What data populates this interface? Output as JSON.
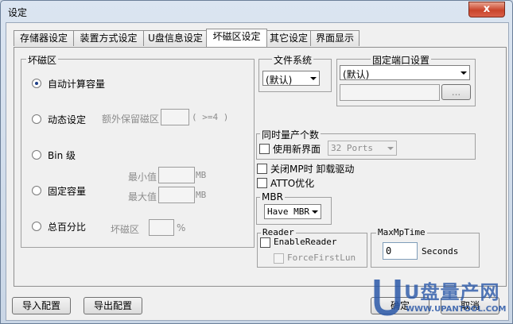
{
  "window": {
    "title": "设定",
    "close_glyph": "x"
  },
  "tabs": [
    {
      "label": "存储器设定"
    },
    {
      "label": "装置方式设定"
    },
    {
      "label": "U盘信息设定"
    },
    {
      "label": "坏磁区设定",
      "active": true
    },
    {
      "label": "其它设定"
    },
    {
      "label": "界面显示"
    }
  ],
  "bad_block": {
    "group_title": "坏磁区",
    "auto": {
      "label": "自动计算容量",
      "selected": true
    },
    "dynamic": {
      "label": "动态设定",
      "extra_label": "额外保留磁区",
      "hint": "( >=4 )"
    },
    "bin": {
      "label": "Bin 级"
    },
    "fixed": {
      "label": "固定容量",
      "min_label": "最小值",
      "max_label": "最大值",
      "unit": "MB"
    },
    "percent": {
      "label": "总百分比",
      "bad_label": "坏磁区",
      "unit": "%"
    }
  },
  "filesystem": {
    "group_title": "文件系统",
    "selected": "(默认)"
  },
  "fixed_port": {
    "group_title": "固定端口设置",
    "selected": "(默认)",
    "browse_label": "..."
  },
  "simultaneous": {
    "group_title": "同时量产个数",
    "new_ui_label": "使用新界面",
    "ports_selected": "32 Ports"
  },
  "options": {
    "close_mp_label": "关闭MP时 卸载驱动",
    "atto_label": "ATTO优化"
  },
  "mbr": {
    "group_title": "MBR",
    "selected": "Have MBR"
  },
  "reader": {
    "group_title": "Reader",
    "enable_label": "EnableReader",
    "force_label": "ForceFirstLun"
  },
  "maxmptime": {
    "group_title": "MaxMpTime",
    "value": "0",
    "unit": "Seconds"
  },
  "footer": {
    "import_label": "导入配置",
    "export_label": "导出配置",
    "ok_label": "确定",
    "cancel_label": "取消"
  },
  "watermark": {
    "brand": "U盘量产网",
    "url": "WWW.UPANTOOL.COM"
  },
  "colors": {
    "accent": "#1f4fa3",
    "watermark_blue": "#2a58a8",
    "close_red": "#c9442b"
  }
}
